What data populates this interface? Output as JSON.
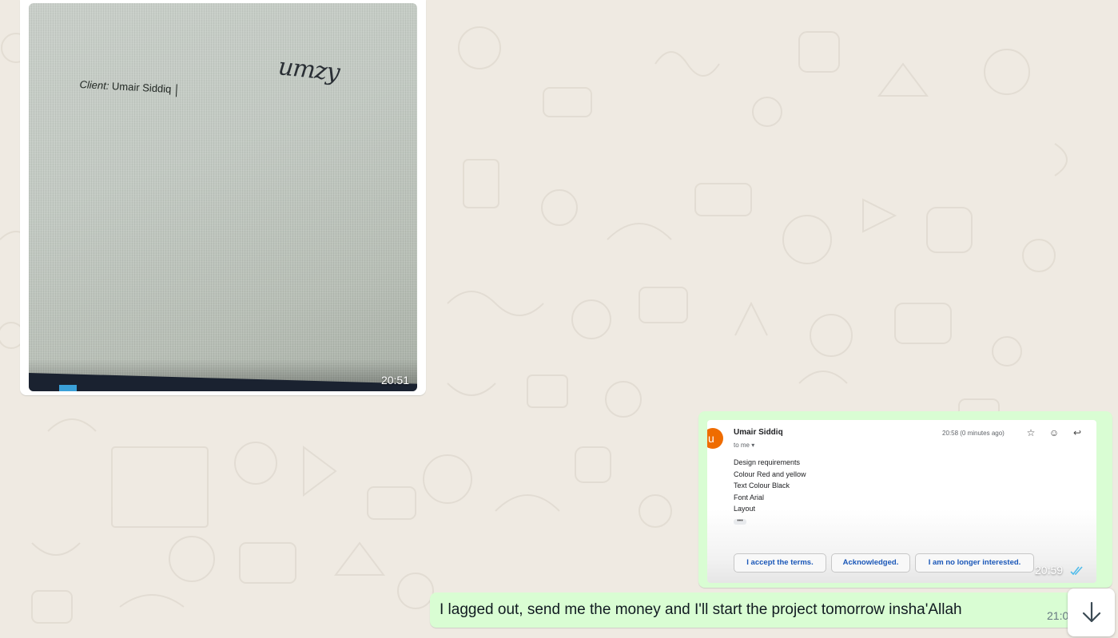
{
  "incoming_image": {
    "photo_client_label": "Client:",
    "photo_client_name": "Umair Siddiq",
    "photo_logo_text": "umzy",
    "time": "20:51"
  },
  "outgoing_email_image": {
    "avatar_letter": "u",
    "sender": "Umair Siddiq",
    "to": "to me ▾",
    "time_sent": "20:58 (0 minutes ago)",
    "body_lines": [
      "Design requirements",
      "Colour Red and yellow",
      "Text Colour Black",
      "Font Arial",
      "Layout"
    ],
    "more_indicator": "•••",
    "reply_chips": [
      "I accept the terms.",
      "Acknowledged.",
      "I am no longer interested."
    ],
    "star_icon": "☆",
    "emoji_icon": "☺",
    "reply_icon": "↩",
    "time": "20:59",
    "status_icon": "double-check-read",
    "status_color": "#53bdeb"
  },
  "outgoing_text": {
    "text": "I lagged out, send me the money and I'll start the project tomorrow insha'Allah",
    "time": "21:0"
  },
  "colors": {
    "background": "#efeae2",
    "outgoing_bubble": "#d9fdd3",
    "incoming_bubble": "#ffffff"
  }
}
